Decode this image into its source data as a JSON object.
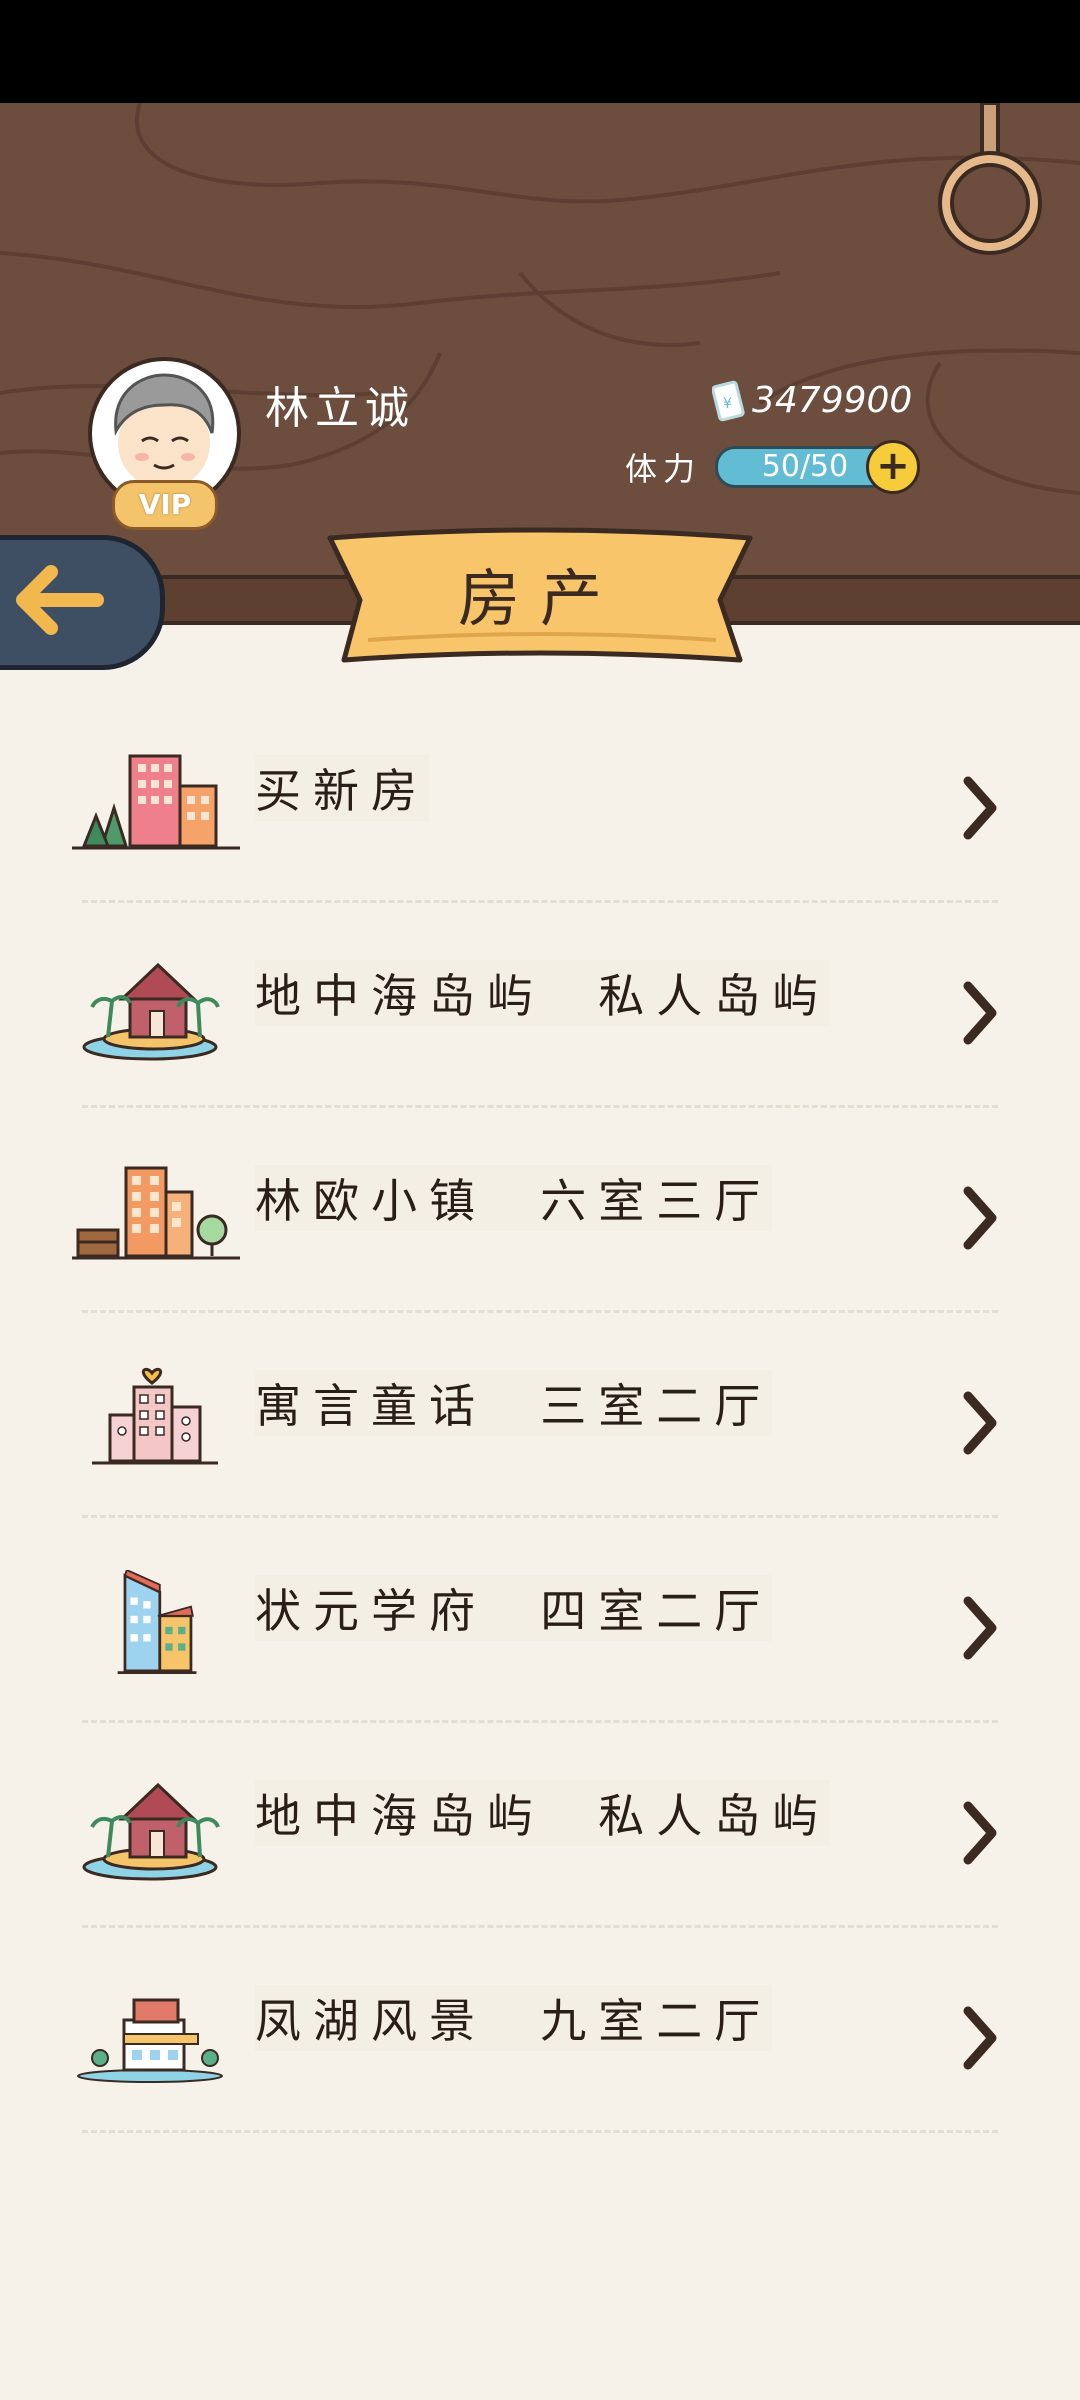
{
  "player": {
    "name": "林立诚",
    "vip": "VIP",
    "money": "3479900",
    "stamina_label": "体力",
    "stamina_value": "50/50",
    "stamina_fraction": 1.0
  },
  "page": {
    "title": "房产"
  },
  "list": {
    "items": [
      {
        "label": "买新房",
        "icon": "city-buildings-icon"
      },
      {
        "label": "地中海岛屿  私人岛屿",
        "icon": "island-house-icon"
      },
      {
        "label": "林欧小镇  六室三厅",
        "icon": "town-building-icon"
      },
      {
        "label": "寓言童话  三室二厅",
        "icon": "pink-apartment-icon"
      },
      {
        "label": "状元学府  四室二厅",
        "icon": "tower-apartment-icon"
      },
      {
        "label": "地中海岛屿  私人岛屿",
        "icon": "island-house-icon"
      },
      {
        "label": "凤湖风景  九室二厅",
        "icon": "lakeside-villa-icon"
      }
    ]
  },
  "colors": {
    "header_wood": "#6d4d3e",
    "background": "#f7f2e9",
    "ribbon": "#f8c56a",
    "stamina": "#62bcd3",
    "back_button": "#3e4f63"
  }
}
